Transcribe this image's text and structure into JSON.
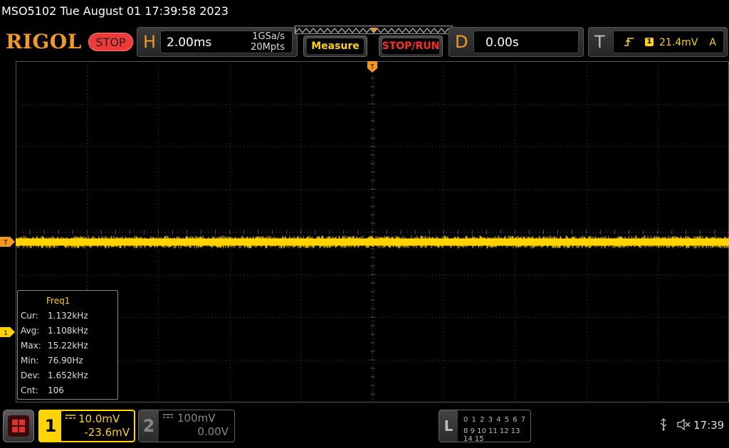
{
  "titlebar": {
    "text": "MSO5102  Tue August 01 17:39:58 2023"
  },
  "header": {
    "logo": "RIGOL",
    "run_state": "STOP",
    "horizontal": {
      "letter": "H",
      "timebase": "2.00ms",
      "sample_rate": "1GSa/s",
      "memory_depth": "20Mpts"
    },
    "measure_label": "Measure",
    "stoprun_label": "STOP/RUN",
    "delay": {
      "letter": "D",
      "value": "0.00s"
    },
    "trigger": {
      "letter": "T",
      "source": "1",
      "level": "21.4mV",
      "mode": "A",
      "edge_icon": "rising-edge-icon"
    }
  },
  "waveform": {
    "trigger_marker": "T",
    "ch1_marker": "1",
    "color": "#ffd400",
    "level_fraction": 0.53
  },
  "measurement": {
    "title": "Freq1",
    "rows": [
      {
        "label": "Cur:",
        "value": "1.132kHz"
      },
      {
        "label": "Avg:",
        "value": "1.108kHz"
      },
      {
        "label": "Max:",
        "value": "15.22kHz"
      },
      {
        "label": "Min:",
        "value": "76.90Hz"
      },
      {
        "label": "Dev:",
        "value": "1.652kHz"
      },
      {
        "label": "Cnt:",
        "value": "106"
      }
    ]
  },
  "footer": {
    "ch1": {
      "num": "1",
      "coupling_icon": "dc-coupling-icon",
      "scale": "10.0mV",
      "offset": "-23.6mV"
    },
    "ch2": {
      "num": "2",
      "coupling_icon": "dc-coupling-icon",
      "scale": "100mV",
      "offset": "0.00V"
    },
    "la": {
      "letter": "L",
      "row1": "0 1 2 3  4 5 6 7",
      "row2": "8 9 10 11 12 13 14 15"
    },
    "clock": "17:39"
  },
  "colors": {
    "accent": "#f39a1e",
    "ch1": "#ffd400",
    "stop": "#ef3a3a"
  }
}
